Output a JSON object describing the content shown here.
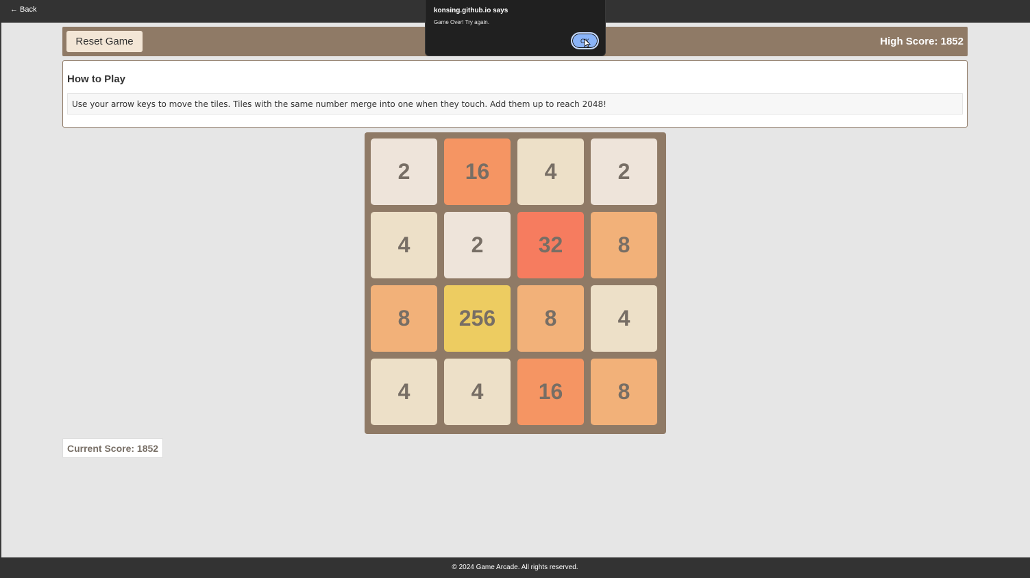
{
  "topbar": {
    "back_label": "← Back"
  },
  "header": {
    "reset_label": "Reset Game",
    "high_score_label": "High Score: 1852"
  },
  "howto": {
    "title": "How to Play",
    "text": "Use your arrow keys to move the tiles. Tiles with the same number merge into one when they touch. Add them up to reach 2048!"
  },
  "board": {
    "rows": [
      [
        "2",
        "16",
        "4",
        "2"
      ],
      [
        "4",
        "2",
        "32",
        "8"
      ],
      [
        "8",
        "256",
        "8",
        "4"
      ],
      [
        "4",
        "4",
        "16",
        "8"
      ]
    ]
  },
  "tile_colors": {
    "2": "#eee4da",
    "4": "#ede0c8",
    "8": "#f2b179",
    "16": "#f59563",
    "32": "#f67c5f",
    "256": "#edcc61"
  },
  "current_score_label": "Current Score: 1852",
  "footer": {
    "text": "© 2024 Game Arcade. All rights reserved."
  },
  "dialog": {
    "title": "konsing.github.io says",
    "message": "Game Over! Try again.",
    "ok_label": "OK"
  }
}
